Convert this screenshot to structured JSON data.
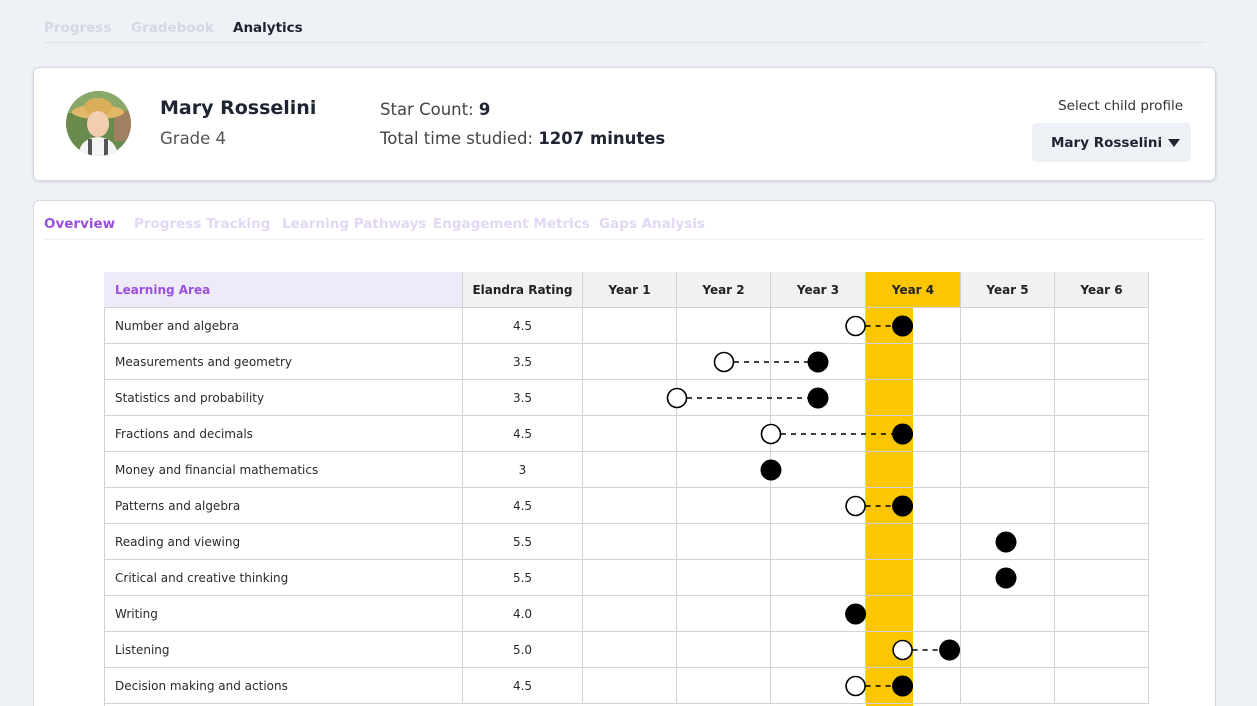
{
  "top_nav": {
    "tabs": [
      {
        "label": "Progress"
      },
      {
        "label": "Gradebook"
      },
      {
        "label": "Analytics"
      }
    ],
    "active": 2
  },
  "profile": {
    "name": "Mary Rosselini",
    "grade": "Grade 4",
    "star_count_label": "Star Count:",
    "star_count": "9",
    "time_label": "Total time studied:",
    "time_value": "1207 minutes",
    "select_label": "Select child profile",
    "selected_child": "Mary Rosselini"
  },
  "sub_tabs": [
    {
      "label": "Overview"
    },
    {
      "label": "Progress Tracking"
    },
    {
      "label": "Learning Pathways"
    },
    {
      "label": "Engagement Metrics"
    },
    {
      "label": "Gaps Analysis"
    }
  ],
  "table": {
    "headers": {
      "area": "Learning Area",
      "rating": "Elandra Rating",
      "years": [
        "Year 1",
        "Year 2",
        "Year 3",
        "Year 4",
        "Year 5",
        "Year 6"
      ]
    },
    "highlight_year": "Year 4",
    "highlight_color": "#fcc602",
    "rows": [
      {
        "area": "Number and algebra",
        "rating": "4.5",
        "from": 3.9,
        "to": 4.4
      },
      {
        "area": "Measurements and geometry",
        "rating": "3.5",
        "from": 2.5,
        "to": 3.5
      },
      {
        "area": "Statistics and probability",
        "rating": "3.5",
        "from": 2.0,
        "to": 3.5
      },
      {
        "area": "Fractions and decimals",
        "rating": "4.5",
        "from": 3.0,
        "to": 4.4
      },
      {
        "area": "Money and financial mathematics",
        "rating": "3",
        "from": null,
        "to": 3.0
      },
      {
        "area": "Patterns and algebra",
        "rating": "4.5",
        "from": 3.9,
        "to": 4.4
      },
      {
        "area": "Reading and viewing",
        "rating": "5.5",
        "from": null,
        "to": 5.5
      },
      {
        "area": "Critical and creative thinking",
        "rating": "5.5",
        "from": null,
        "to": 5.5
      },
      {
        "area": "Writing",
        "rating": "4.0",
        "from": null,
        "to": 3.9
      },
      {
        "area": "Listening",
        "rating": "5.0",
        "from": 4.4,
        "to": 4.9
      },
      {
        "area": "Decision making and actions",
        "rating": "4.5",
        "from": 3.9,
        "to": 4.4
      }
    ]
  }
}
